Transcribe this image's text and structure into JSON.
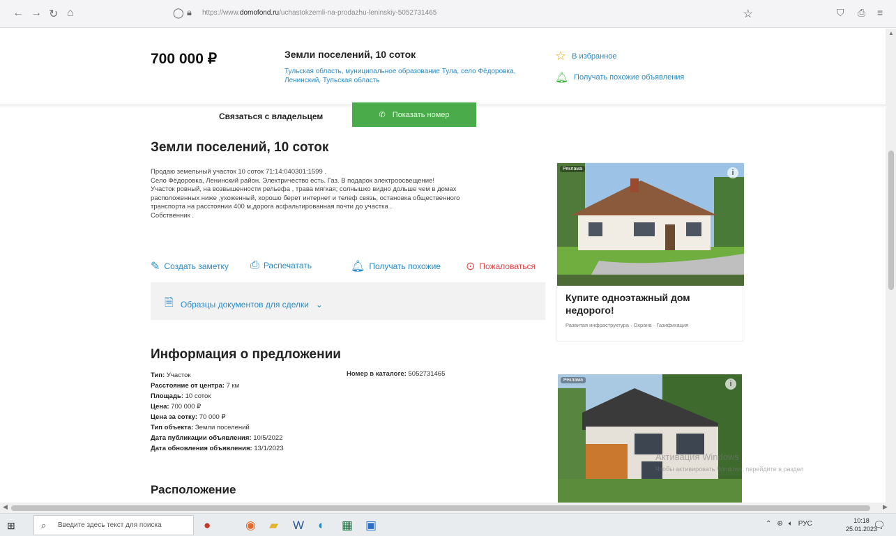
{
  "browser": {
    "url_prefix": "https://www.",
    "url_domain": "domofond.ru",
    "url_path": "/uchastokzemli-na-prodazhu-leninskiy-5052731465"
  },
  "header": {
    "price": "700 000 ₽",
    "title": "Земли поселений, 10 соток",
    "address": "Тульская область, муниципальное образование Тула, село Фёдоровка, Ленинский, Тульская область",
    "favorite_label": "В избранное",
    "similar_label": "Получать похожие объявления"
  },
  "contact": {
    "label": "Связаться с владельцем",
    "show_phone": "Показать номер"
  },
  "listing": {
    "title": "Земли поселений, 10 соток",
    "description": [
      "Продаю земельный участок 10 соток 71:14:040301:1599 .",
      "Село Фёдоровка, Ленинский район. Электричество есть. Газ. В подарок электроосвещение!",
      "Участок ровный, на возвышенности рельефа , трава мягкая; солнышко видно дольше чем в домах",
      "расположенных ниже ,ухоженный, хорошо берет интернет и телеф связь, остановка общественного",
      "транспорта на расстоянии 400 м,дорога асфальтированная почти до участка .",
      "Собственник ."
    ],
    "actions": {
      "note": "Создать заметку",
      "print": "Распечатать",
      "similar": "Получать похожие",
      "report": "Пожаловаться"
    },
    "docs_link": "Образцы документов для сделки"
  },
  "info": {
    "title": "Информация о предложении",
    "rows": [
      {
        "label": "Тип:",
        "value": "Участок"
      },
      {
        "label": "Расстояние от центра:",
        "value": "7 км"
      },
      {
        "label": "Площадь:",
        "value": "10 соток"
      },
      {
        "label": "Цена:",
        "value": "700 000 ₽"
      },
      {
        "label": "Цена за сотку:",
        "value": "70 000 ₽"
      },
      {
        "label": "Тип объекта:",
        "value": "Земли поселений"
      },
      {
        "label": "Дата публикации объявления:",
        "value": "10/5/2022"
      },
      {
        "label": "Дата обновления объявления:",
        "value": "13/1/2023"
      }
    ],
    "catalog_label": "Номер в каталоге:",
    "catalog_value": "5052731465",
    "location_title": "Расположение"
  },
  "ad1": {
    "tag": "Реклама",
    "title": "Купите одноэтажный дом недорого!",
    "description": "Развитая инфраструктура · Охрана · Газификация"
  },
  "watermark": {
    "line1": "Активация Windows",
    "line2": "Чтобы активировать Windows, перейдите в раздел"
  },
  "taskbar": {
    "search_placeholder": "Введите здесь текст для поиска",
    "lang": "РУС",
    "time": "10:18",
    "date": "25.01.2023"
  },
  "colors": {
    "link": "#2a8bc7",
    "green_button": "#4aab4a",
    "report": "#e54848",
    "star": "#f0a500"
  }
}
